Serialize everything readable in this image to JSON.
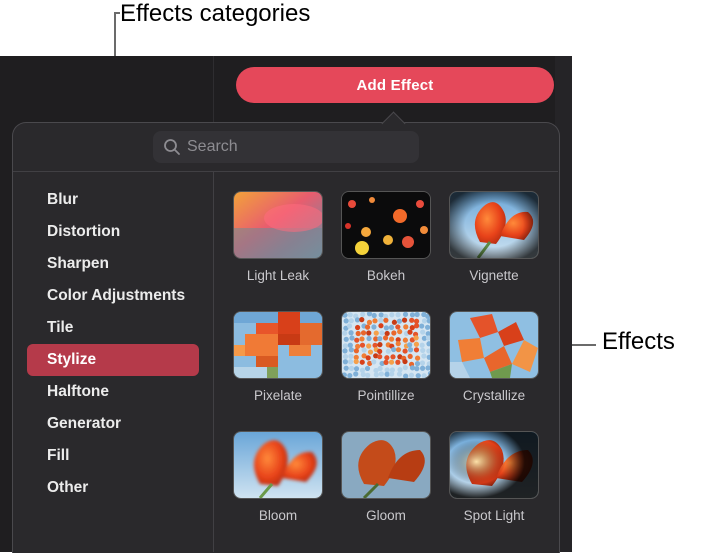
{
  "annotations": {
    "categories_label": "Effects categories",
    "effects_label": "Effects"
  },
  "toolbar": {
    "add_effect_label": "Add Effect"
  },
  "search": {
    "placeholder": "Search"
  },
  "categories": [
    {
      "label": "Blur",
      "selected": false
    },
    {
      "label": "Distortion",
      "selected": false
    },
    {
      "label": "Sharpen",
      "selected": false
    },
    {
      "label": "Color Adjustments",
      "selected": false
    },
    {
      "label": "Tile",
      "selected": false
    },
    {
      "label": "Stylize",
      "selected": true
    },
    {
      "label": "Halftone",
      "selected": false
    },
    {
      "label": "Generator",
      "selected": false
    },
    {
      "label": "Fill",
      "selected": false
    },
    {
      "label": "Other",
      "selected": false
    }
  ],
  "effects": [
    {
      "label": "Light Leak"
    },
    {
      "label": "Bokeh"
    },
    {
      "label": "Vignette"
    },
    {
      "label": "Pixelate"
    },
    {
      "label": "Pointillize"
    },
    {
      "label": "Crystallize"
    },
    {
      "label": "Bloom"
    },
    {
      "label": "Gloom"
    },
    {
      "label": "Spot Light"
    }
  ],
  "colors": {
    "accent": "#e5485a",
    "selected_category": "#b53a4a",
    "popover_bg": "#2a292c"
  }
}
